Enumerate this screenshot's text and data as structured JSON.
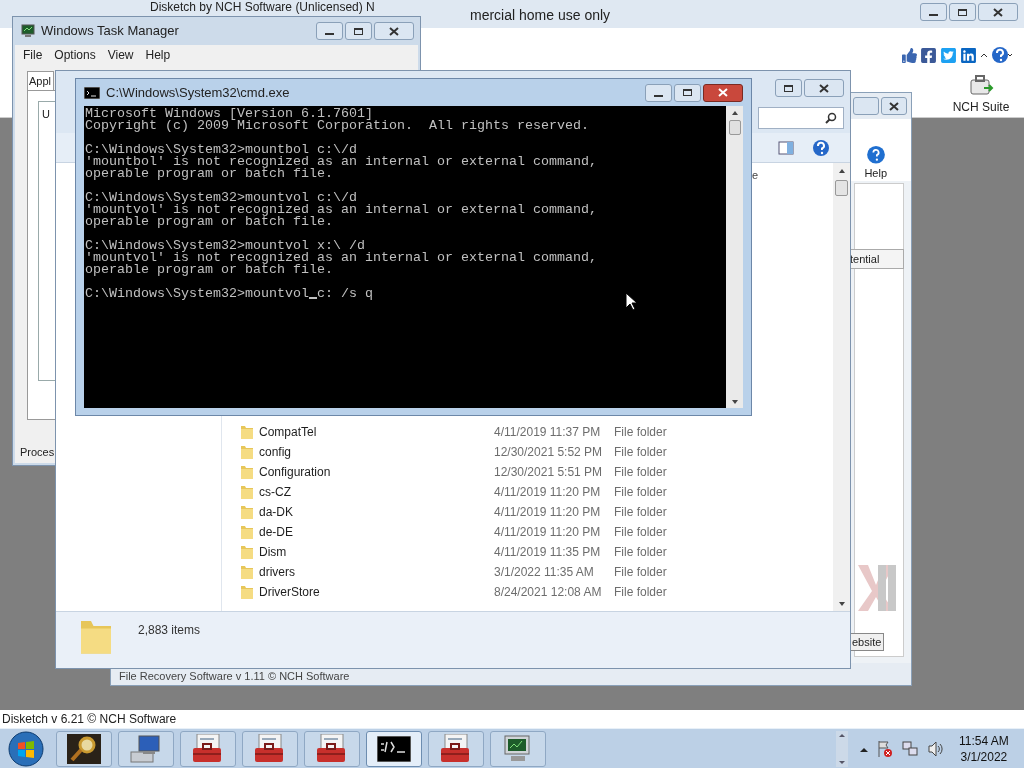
{
  "background_app": {
    "title_parts": [
      "Disketch by NCH Software (Unlicensed) N",
      "mercial home use only"
    ],
    "suite_button": "NCH Suite",
    "status_bar": "Disketch v 6.21 © NCH Software"
  },
  "recovery_window": {
    "help_button": "Help",
    "tab_fragment": "tential",
    "button_fragment": "ebsite",
    "status_fragment": "File Recovery Software v 1.11 © NCH Software"
  },
  "explorer": {
    "column_fragment": "e",
    "files": [
      {
        "name": "CompatTel",
        "date": "4/11/2019 11:37 PM",
        "type": "File folder"
      },
      {
        "name": "config",
        "date": "12/30/2021 5:52 PM",
        "type": "File folder"
      },
      {
        "name": "Configuration",
        "date": "12/30/2021 5:51 PM",
        "type": "File folder"
      },
      {
        "name": "cs-CZ",
        "date": "4/11/2019 11:20 PM",
        "type": "File folder"
      },
      {
        "name": "da-DK",
        "date": "4/11/2019 11:20 PM",
        "type": "File folder"
      },
      {
        "name": "de-DE",
        "date": "4/11/2019 11:20 PM",
        "type": "File folder"
      },
      {
        "name": "Dism",
        "date": "4/11/2019 11:35 PM",
        "type": "File folder"
      },
      {
        "name": "drivers",
        "date": "3/1/2022 11:35 AM",
        "type": "File folder"
      },
      {
        "name": "DriverStore",
        "date": "8/24/2021 12:08 AM",
        "type": "File folder"
      }
    ],
    "item_count": "2,883 items"
  },
  "task_manager": {
    "title": "Windows Task Manager",
    "menu": [
      "File",
      "Options",
      "View",
      "Help"
    ],
    "tab_fragment": "Appl",
    "list_fragment": "U",
    "status_fragment": "Proces"
  },
  "cmd": {
    "title": "C:\\Windows\\System32\\cmd.exe",
    "blocks": [
      [
        "Microsoft Windows [Version 6.1.7601]",
        "Copyright (c) 2009 Microsoft Corporation.  All rights reserved."
      ],
      [
        "C:\\Windows\\System32>mountbol c:\\/d",
        "'mountbol' is not recognized as an internal or external command,",
        "operable program or batch file."
      ],
      [
        "C:\\Windows\\System32>mountvol c:\\/d",
        "'mountvol' is not recognized as an internal or external command,",
        "operable program or batch file."
      ],
      [
        "C:\\Windows\\System32>mountvol x:\\ /d",
        "'mountvol' is not recognized as an internal or external command,",
        "operable program or batch file."
      ]
    ],
    "input_before": "C:\\Windows\\System32>mountvol",
    "input_after": "c: /s q"
  },
  "taskbar": {
    "buttons": [
      {
        "kind": "magnifier",
        "active": false
      },
      {
        "kind": "computer",
        "active": false
      },
      {
        "kind": "toolbox",
        "active": false
      },
      {
        "kind": "toolbox",
        "active": false
      },
      {
        "kind": "toolbox",
        "active": false
      },
      {
        "kind": "console",
        "active": true
      },
      {
        "kind": "toolbox",
        "active": false
      },
      {
        "kind": "monitor",
        "active": false
      }
    ],
    "time": "11:54 AM",
    "date": "3/1/2022"
  }
}
